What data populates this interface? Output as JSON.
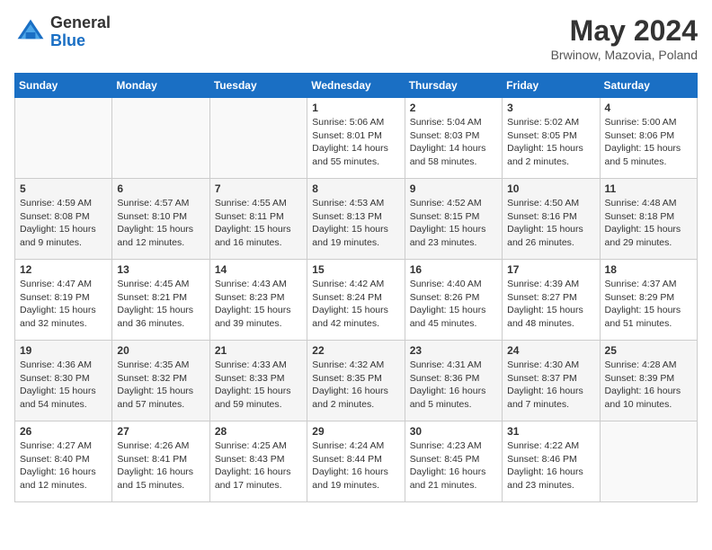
{
  "header": {
    "logo_general": "General",
    "logo_blue": "Blue",
    "title": "May 2024",
    "location": "Brwinow, Mazovia, Poland"
  },
  "days_of_week": [
    "Sunday",
    "Monday",
    "Tuesday",
    "Wednesday",
    "Thursday",
    "Friday",
    "Saturday"
  ],
  "weeks": [
    [
      {
        "day": "",
        "info": ""
      },
      {
        "day": "",
        "info": ""
      },
      {
        "day": "",
        "info": ""
      },
      {
        "day": "1",
        "info": "Sunrise: 5:06 AM\nSunset: 8:01 PM\nDaylight: 14 hours and 55 minutes."
      },
      {
        "day": "2",
        "info": "Sunrise: 5:04 AM\nSunset: 8:03 PM\nDaylight: 14 hours and 58 minutes."
      },
      {
        "day": "3",
        "info": "Sunrise: 5:02 AM\nSunset: 8:05 PM\nDaylight: 15 hours and 2 minutes."
      },
      {
        "day": "4",
        "info": "Sunrise: 5:00 AM\nSunset: 8:06 PM\nDaylight: 15 hours and 5 minutes."
      }
    ],
    [
      {
        "day": "5",
        "info": "Sunrise: 4:59 AM\nSunset: 8:08 PM\nDaylight: 15 hours and 9 minutes."
      },
      {
        "day": "6",
        "info": "Sunrise: 4:57 AM\nSunset: 8:10 PM\nDaylight: 15 hours and 12 minutes."
      },
      {
        "day": "7",
        "info": "Sunrise: 4:55 AM\nSunset: 8:11 PM\nDaylight: 15 hours and 16 minutes."
      },
      {
        "day": "8",
        "info": "Sunrise: 4:53 AM\nSunset: 8:13 PM\nDaylight: 15 hours and 19 minutes."
      },
      {
        "day": "9",
        "info": "Sunrise: 4:52 AM\nSunset: 8:15 PM\nDaylight: 15 hours and 23 minutes."
      },
      {
        "day": "10",
        "info": "Sunrise: 4:50 AM\nSunset: 8:16 PM\nDaylight: 15 hours and 26 minutes."
      },
      {
        "day": "11",
        "info": "Sunrise: 4:48 AM\nSunset: 8:18 PM\nDaylight: 15 hours and 29 minutes."
      }
    ],
    [
      {
        "day": "12",
        "info": "Sunrise: 4:47 AM\nSunset: 8:19 PM\nDaylight: 15 hours and 32 minutes."
      },
      {
        "day": "13",
        "info": "Sunrise: 4:45 AM\nSunset: 8:21 PM\nDaylight: 15 hours and 36 minutes."
      },
      {
        "day": "14",
        "info": "Sunrise: 4:43 AM\nSunset: 8:23 PM\nDaylight: 15 hours and 39 minutes."
      },
      {
        "day": "15",
        "info": "Sunrise: 4:42 AM\nSunset: 8:24 PM\nDaylight: 15 hours and 42 minutes."
      },
      {
        "day": "16",
        "info": "Sunrise: 4:40 AM\nSunset: 8:26 PM\nDaylight: 15 hours and 45 minutes."
      },
      {
        "day": "17",
        "info": "Sunrise: 4:39 AM\nSunset: 8:27 PM\nDaylight: 15 hours and 48 minutes."
      },
      {
        "day": "18",
        "info": "Sunrise: 4:37 AM\nSunset: 8:29 PM\nDaylight: 15 hours and 51 minutes."
      }
    ],
    [
      {
        "day": "19",
        "info": "Sunrise: 4:36 AM\nSunset: 8:30 PM\nDaylight: 15 hours and 54 minutes."
      },
      {
        "day": "20",
        "info": "Sunrise: 4:35 AM\nSunset: 8:32 PM\nDaylight: 15 hours and 57 minutes."
      },
      {
        "day": "21",
        "info": "Sunrise: 4:33 AM\nSunset: 8:33 PM\nDaylight: 15 hours and 59 minutes."
      },
      {
        "day": "22",
        "info": "Sunrise: 4:32 AM\nSunset: 8:35 PM\nDaylight: 16 hours and 2 minutes."
      },
      {
        "day": "23",
        "info": "Sunrise: 4:31 AM\nSunset: 8:36 PM\nDaylight: 16 hours and 5 minutes."
      },
      {
        "day": "24",
        "info": "Sunrise: 4:30 AM\nSunset: 8:37 PM\nDaylight: 16 hours and 7 minutes."
      },
      {
        "day": "25",
        "info": "Sunrise: 4:28 AM\nSunset: 8:39 PM\nDaylight: 16 hours and 10 minutes."
      }
    ],
    [
      {
        "day": "26",
        "info": "Sunrise: 4:27 AM\nSunset: 8:40 PM\nDaylight: 16 hours and 12 minutes."
      },
      {
        "day": "27",
        "info": "Sunrise: 4:26 AM\nSunset: 8:41 PM\nDaylight: 16 hours and 15 minutes."
      },
      {
        "day": "28",
        "info": "Sunrise: 4:25 AM\nSunset: 8:43 PM\nDaylight: 16 hours and 17 minutes."
      },
      {
        "day": "29",
        "info": "Sunrise: 4:24 AM\nSunset: 8:44 PM\nDaylight: 16 hours and 19 minutes."
      },
      {
        "day": "30",
        "info": "Sunrise: 4:23 AM\nSunset: 8:45 PM\nDaylight: 16 hours and 21 minutes."
      },
      {
        "day": "31",
        "info": "Sunrise: 4:22 AM\nSunset: 8:46 PM\nDaylight: 16 hours and 23 minutes."
      },
      {
        "day": "",
        "info": ""
      }
    ]
  ]
}
